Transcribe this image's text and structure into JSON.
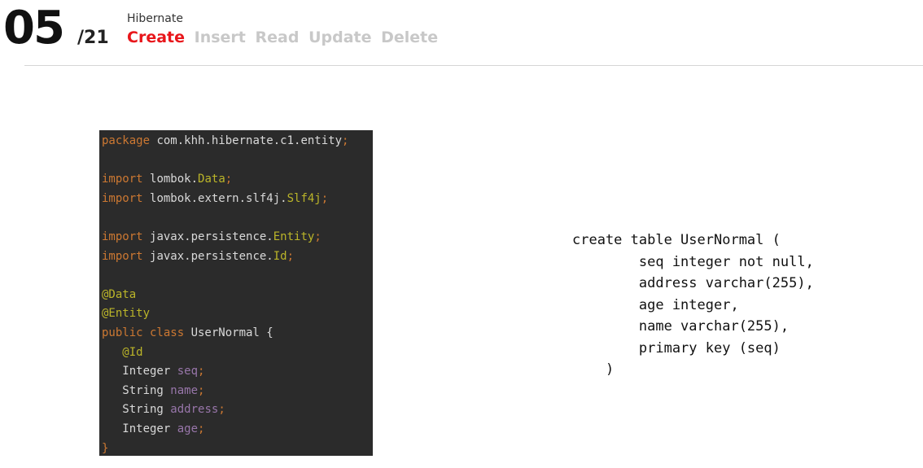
{
  "header": {
    "slide_number": "05",
    "slide_total": "/21",
    "topic": "Hibernate",
    "crud_items": [
      {
        "label": "Create",
        "active": true
      },
      {
        "label": "Insert",
        "active": false
      },
      {
        "label": "Read",
        "active": false
      },
      {
        "label": "Update",
        "active": false
      },
      {
        "label": "Delete",
        "active": false
      }
    ]
  },
  "java_code": {
    "lines": [
      [
        {
          "t": "package ",
          "c": "k"
        },
        {
          "t": "com.khh.hibernate.c1.entity",
          "c": ""
        },
        {
          "t": ";",
          "c": "p"
        }
      ],
      [],
      [
        {
          "t": "import ",
          "c": "k"
        },
        {
          "t": "lombok.",
          "c": ""
        },
        {
          "t": "Data",
          "c": "a"
        },
        {
          "t": ";",
          "c": "p"
        }
      ],
      [
        {
          "t": "import ",
          "c": "k"
        },
        {
          "t": "lombok.extern.slf4j.",
          "c": ""
        },
        {
          "t": "Slf4j",
          "c": "a"
        },
        {
          "t": ";",
          "c": "p"
        }
      ],
      [],
      [
        {
          "t": "import ",
          "c": "k"
        },
        {
          "t": "javax.persistence.",
          "c": ""
        },
        {
          "t": "Entity",
          "c": "a"
        },
        {
          "t": ";",
          "c": "p"
        }
      ],
      [
        {
          "t": "import ",
          "c": "k"
        },
        {
          "t": "javax.persistence.",
          "c": ""
        },
        {
          "t": "Id",
          "c": "a"
        },
        {
          "t": ";",
          "c": "p"
        }
      ],
      [],
      [
        {
          "t": "@Data",
          "c": "a"
        }
      ],
      [
        {
          "t": "@Entity",
          "c": "a"
        }
      ],
      [
        {
          "t": "public class ",
          "c": "k"
        },
        {
          "t": "UserNormal {",
          "c": ""
        }
      ],
      [
        {
          "t": "   @Id",
          "c": "a"
        }
      ],
      [
        {
          "t": "   Integer ",
          "c": ""
        },
        {
          "t": "seq",
          "c": "f"
        },
        {
          "t": ";",
          "c": "p"
        }
      ],
      [
        {
          "t": "   String ",
          "c": ""
        },
        {
          "t": "name",
          "c": "f"
        },
        {
          "t": ";",
          "c": "p"
        }
      ],
      [
        {
          "t": "   String ",
          "c": ""
        },
        {
          "t": "address",
          "c": "f"
        },
        {
          "t": ";",
          "c": "p"
        }
      ],
      [
        {
          "t": "   Integer ",
          "c": ""
        },
        {
          "t": "age",
          "c": "f"
        },
        {
          "t": ";",
          "c": "p"
        }
      ],
      [
        {
          "t": "}",
          "c": "p"
        }
      ]
    ]
  },
  "sql_code": {
    "lines": [
      "create table UserNormal (",
      "        seq integer not null,",
      "        address varchar(255),",
      "        age integer,",
      "        name varchar(255),",
      "        primary key (seq)",
      "    )"
    ]
  },
  "colors": {
    "accent": "#e8161b",
    "inactive": "#c8c8c8",
    "code_bg": "#2b2b2b",
    "keyword": "#cc7832",
    "annotation": "#bbb529",
    "field": "#9876aa"
  }
}
